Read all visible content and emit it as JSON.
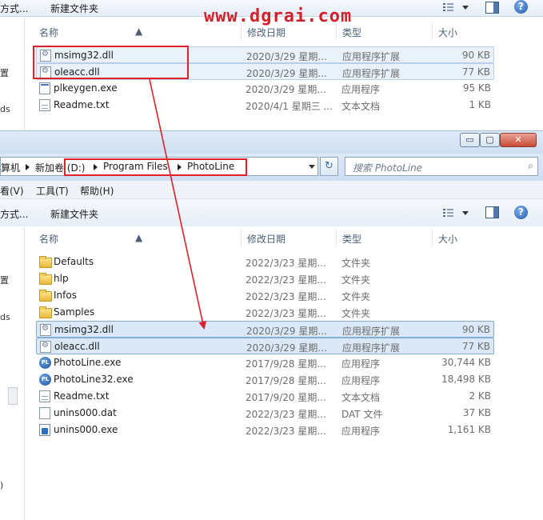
{
  "watermark": "www.dgrai.com",
  "top_window": {
    "cmd_cut": "方式...",
    "cmd_new_folder": "新建文件夹",
    "nav_labels": [
      "置",
      "ds"
    ],
    "columns": {
      "name": "名称",
      "date": "修改日期",
      "type": "类型",
      "size": "大小"
    },
    "files": [
      {
        "name": "msimg32.dll",
        "date": "2020/3/29 星期...",
        "type": "应用程序扩展",
        "size": "90 KB",
        "icon": "dll-icon"
      },
      {
        "name": "oleacc.dll",
        "date": "2020/3/29 星期...",
        "type": "应用程序扩展",
        "size": "77 KB",
        "icon": "dll-icon"
      },
      {
        "name": "plkeygen.exe",
        "date": "2020/3/29 星期...",
        "type": "应用程序",
        "size": "95 KB",
        "icon": "exe-icon"
      },
      {
        "name": "Readme.txt",
        "date": "2020/4/1 星期三 ...",
        "type": "文本文档",
        "size": "1 KB",
        "icon": "text-file-icon"
      }
    ]
  },
  "front_window": {
    "window_buttons": {
      "minimize": "▭",
      "maximize": "▢",
      "close": "✕"
    },
    "address": {
      "crumbs": [
        "算机",
        "新加卷 (D:)",
        "Program Files",
        "PhotoLine"
      ]
    },
    "search": {
      "placeholder": "搜索 PhotoLine"
    },
    "menu": [
      "看(V)",
      "工具(T)",
      "帮助(H)"
    ],
    "cmd_cut": "方式...",
    "cmd_new_folder": "新建文件夹",
    "nav_labels": [
      "置",
      "ds",
      ")"
    ],
    "columns": {
      "name": "名称",
      "date": "修改日期",
      "type": "类型",
      "size": "大小"
    },
    "files": [
      {
        "name": "Defaults",
        "date": "2022/3/23 星期...",
        "type": "文件夹",
        "size": "",
        "icon": "folder-icon"
      },
      {
        "name": "hlp",
        "date": "2022/3/23 星期...",
        "type": "文件夹",
        "size": "",
        "icon": "folder-icon"
      },
      {
        "name": "Infos",
        "date": "2022/3/23 星期...",
        "type": "文件夹",
        "size": "",
        "icon": "folder-icon"
      },
      {
        "name": "Samples",
        "date": "2022/3/23 星期...",
        "type": "文件夹",
        "size": "",
        "icon": "folder-icon"
      },
      {
        "name": "msimg32.dll",
        "date": "2020/3/29 星期...",
        "type": "应用程序扩展",
        "size": "90 KB",
        "icon": "dll-icon"
      },
      {
        "name": "oleacc.dll",
        "date": "2020/3/29 星期...",
        "type": "应用程序扩展",
        "size": "77 KB",
        "icon": "dll-icon"
      },
      {
        "name": "PhotoLine.exe",
        "date": "2017/9/28 星期...",
        "type": "应用程序",
        "size": "30,744 KB",
        "icon": "photoline-icon"
      },
      {
        "name": "PhotoLine32.exe",
        "date": "2017/9/28 星期...",
        "type": "应用程序",
        "size": "18,498 KB",
        "icon": "photoline-icon"
      },
      {
        "name": "Readme.txt",
        "date": "2017/9/20 星期...",
        "type": "文本文档",
        "size": "2 KB",
        "icon": "text-file-icon"
      },
      {
        "name": "unins000.dat",
        "date": "2022/3/23 星期...",
        "type": "DAT 文件",
        "size": "37 KB",
        "icon": "dat-file-icon"
      },
      {
        "name": "unins000.exe",
        "date": "2022/3/23 星期...",
        "type": "应用程序",
        "size": "1,161 KB",
        "icon": "setup-icon"
      }
    ]
  }
}
